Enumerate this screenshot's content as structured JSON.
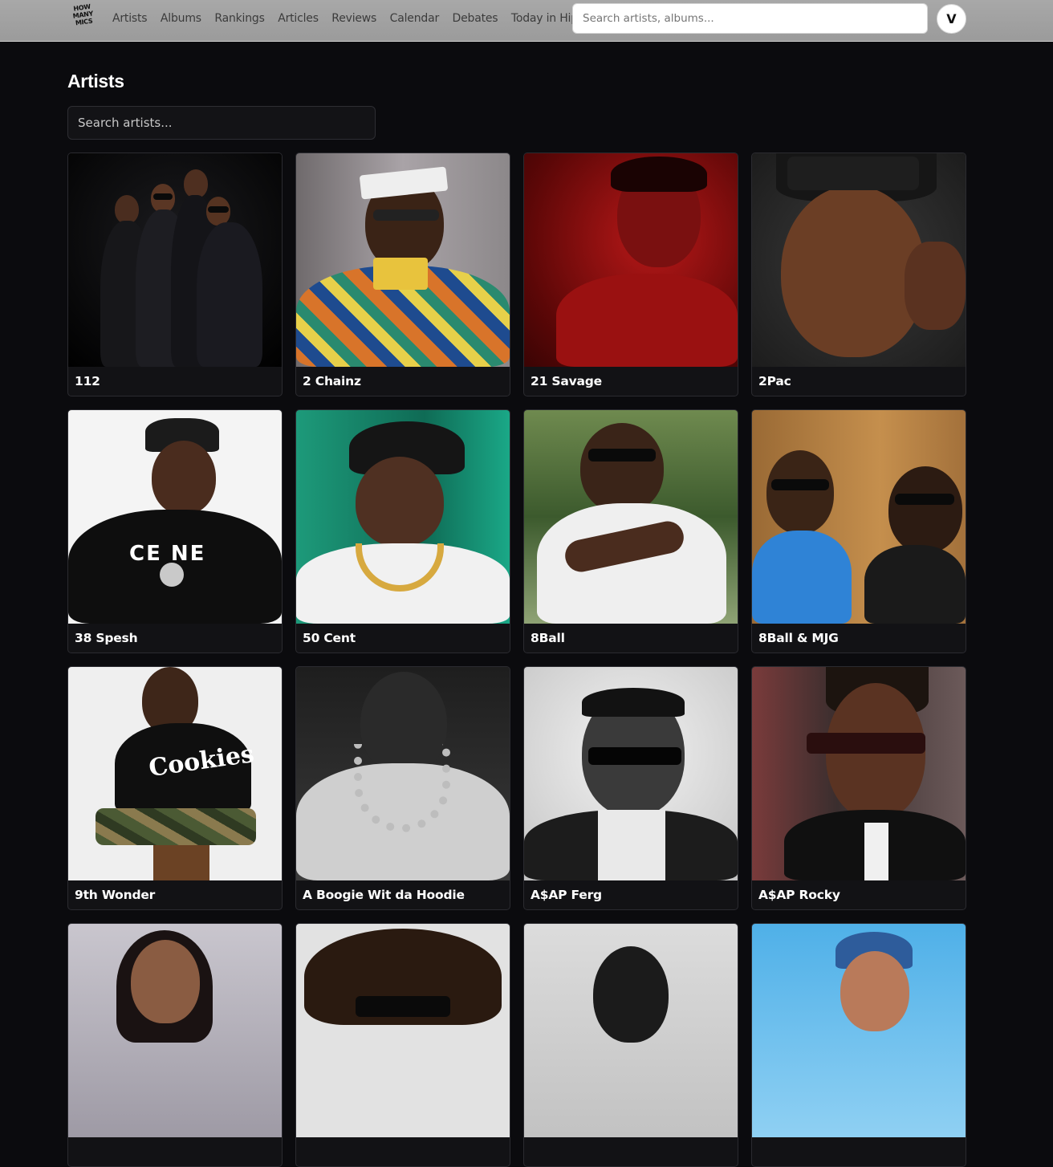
{
  "header": {
    "logo_lines": [
      "HOW",
      "MANY",
      "MICS"
    ],
    "nav": [
      "Artists",
      "Albums",
      "Rankings",
      "Articles",
      "Reviews",
      "Calendar",
      "Debates",
      "Today in Hip-Hop"
    ],
    "search_placeholder": "Search artists, albums...",
    "user_initial": "V"
  },
  "main": {
    "title": "Artists",
    "search_placeholder": "Search artists..."
  },
  "artists": [
    {
      "name": "112"
    },
    {
      "name": "2 Chainz"
    },
    {
      "name": "21 Savage"
    },
    {
      "name": "2Pac"
    },
    {
      "name": "38 Spesh"
    },
    {
      "name": "50 Cent"
    },
    {
      "name": "8Ball"
    },
    {
      "name": "8Ball & MJG"
    },
    {
      "name": "9th Wonder"
    },
    {
      "name": "A Boogie Wit da Hoodie"
    },
    {
      "name": "A$AP Ferg"
    },
    {
      "name": "A$AP Rocky"
    },
    {
      "name": ""
    },
    {
      "name": ""
    },
    {
      "name": ""
    },
    {
      "name": ""
    }
  ]
}
